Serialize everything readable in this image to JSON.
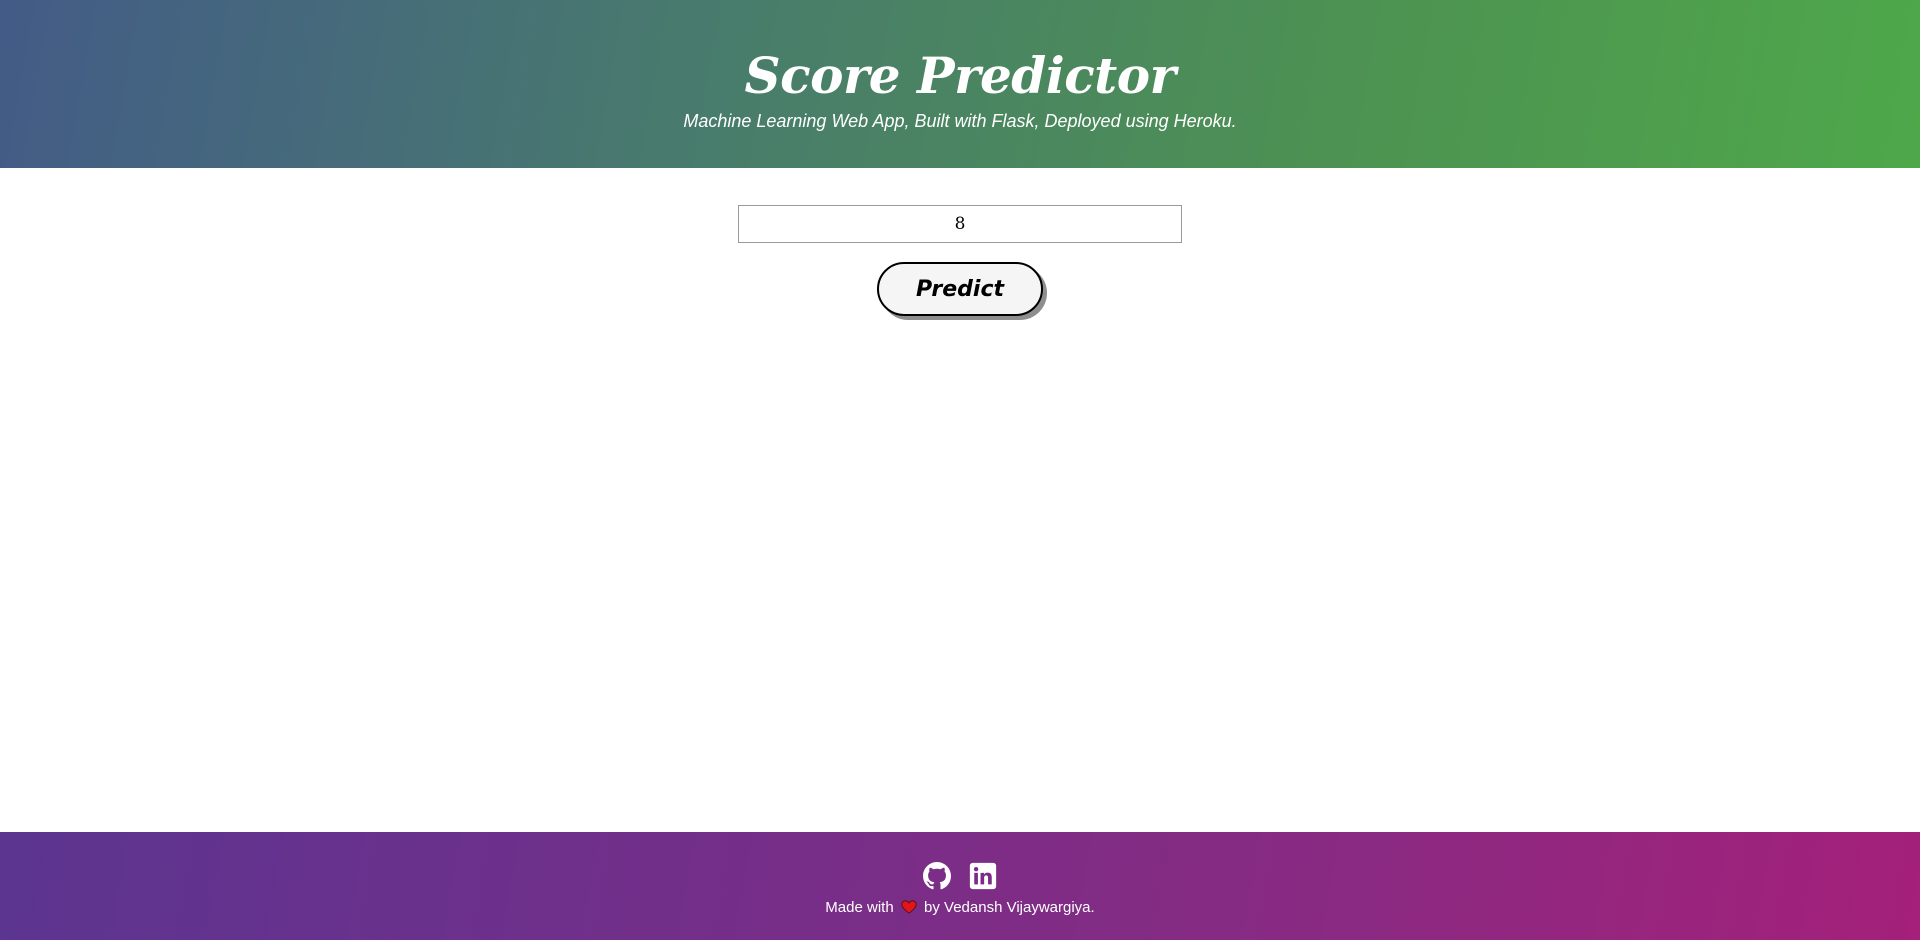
{
  "header": {
    "title": "Score Predictor",
    "subtitle": "Machine Learning Web App, Built with Flask, Deployed using Heroku."
  },
  "form": {
    "hours_input_value": "8",
    "predict_label": "Predict"
  },
  "footer": {
    "icons": [
      "github-icon",
      "linkedin-icon"
    ],
    "credit_prefix": "Made with",
    "credit_icon": "heart-icon",
    "credit_suffix": "by Vedansh Vijaywargiya."
  },
  "colors": {
    "header_gradient": [
      "#435b87",
      "#4ea84a"
    ],
    "footer_gradient": [
      "#5b3590",
      "#a4207a"
    ],
    "heart": "#e0161b"
  }
}
